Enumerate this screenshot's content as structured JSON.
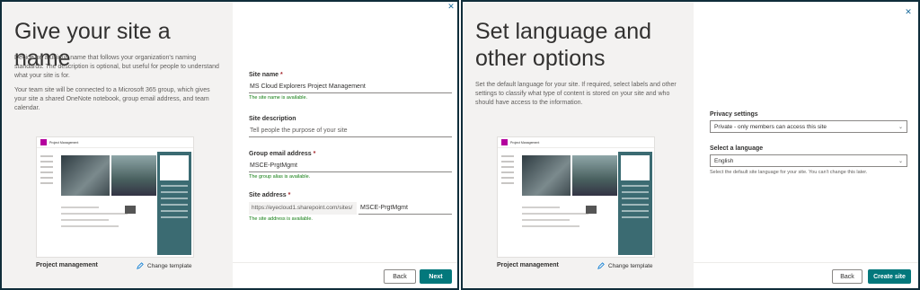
{
  "left": {
    "title": "Give your site a name",
    "desc1": "Decide on a unique name that follows your organization's naming standards. The description is optional, but useful for people to understand what your site is for.",
    "desc2": "Your team site will be connected to a Microsoft 365 group, which gives your site a shared OneNote notebook, group email address, and team calendar.",
    "preview_title": "Project Management",
    "template_name": "Project management",
    "change_template": "Change template",
    "site_name_label": "Site name",
    "site_name_value": "MS Cloud Explorers Project Management",
    "site_name_ok": "The site name is available.",
    "site_desc_label": "Site description",
    "site_desc_placeholder": "Tell people the purpose of your site",
    "email_label": "Group email address",
    "email_value": "MSCE-PrgtMgmt",
    "email_ok": "The group alias is available.",
    "address_label": "Site address",
    "address_prefix": "https://eyecloud1.sharepoint.com/sites/",
    "address_value": "MSCE-PrgtMgmt",
    "address_ok": "The site address is available.",
    "back": "Back",
    "next": "Next",
    "required_mark": "*"
  },
  "right": {
    "title": "Set language and other options",
    "desc": "Set the default language for your site. If required, select labels and other settings to classify what type of content is stored on your site and who should have access to the information.",
    "preview_title": "Project Management",
    "template_name": "Project management",
    "change_template": "Change template",
    "privacy_label": "Privacy settings",
    "privacy_value": "Private - only members can access this site",
    "language_label": "Select a language",
    "language_value": "English",
    "language_hint": "Select the default site language for your site. You can't change this later.",
    "back": "Back",
    "create": "Create site",
    "close_glyph": "✕"
  },
  "colors": {
    "accent": "#03787c",
    "success": "#107c10",
    "border": "#0f2d3a"
  }
}
